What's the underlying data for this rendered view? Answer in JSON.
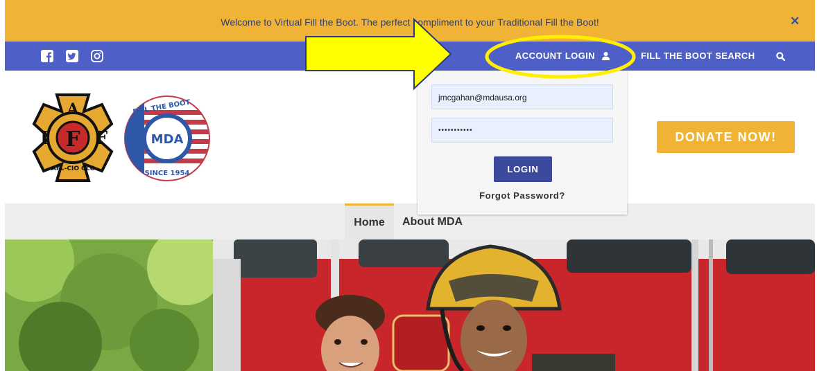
{
  "announcement": {
    "text": "Welcome to Virtual Fill the Boot.  The perfect compliment to your Traditional Fill the Boot!",
    "close_icon": "close-icon"
  },
  "topbar": {
    "social_icons": [
      "facebook-icon",
      "twitter-icon",
      "instagram-icon"
    ],
    "account_login": "ACCOUNT LOGIN",
    "account_icon": "user-icon",
    "search_label": "FILL THE BOOT SEARCH",
    "search_icon": "search-icon"
  },
  "logos": {
    "iaff": {
      "letters": [
        "I",
        "A",
        "F",
        "F"
      ],
      "ring": "AFL-CIO CLC"
    },
    "mda": {
      "top": "FILL THE BOOT",
      "center": "MDA",
      "bottom": "SINCE 1954"
    }
  },
  "donate": {
    "label": "DONATE NOW!"
  },
  "login_form": {
    "email_value": "jmcgahan@mdausa.org",
    "password_value": "•••••••••••",
    "button": "LOGIN",
    "forgot": "Forgot Password?"
  },
  "nav": {
    "items": [
      "Home",
      "About MDA"
    ],
    "active": "Home"
  },
  "colors": {
    "accent": "#f0b335",
    "brand_blue": "#4e5fc7",
    "button_blue": "#3c4a9e",
    "annotation_yellow": "#ffff00"
  }
}
